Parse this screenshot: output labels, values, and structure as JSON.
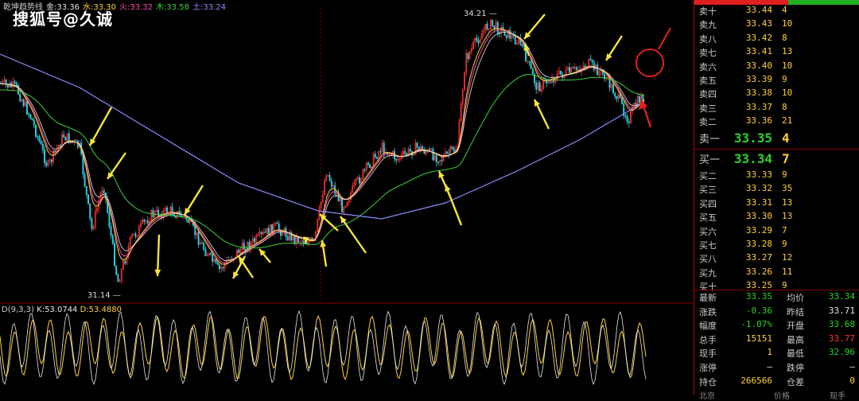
{
  "watermark": "搜狐号@久诚",
  "top_legend": {
    "name": "乾坤趋势线",
    "items": [
      {
        "label": "金:33.36",
        "color": "#e6e6e6"
      },
      {
        "label": "水:33.30",
        "color": "#ffd23c"
      },
      {
        "label": "火:33.32",
        "color": "#ff4da6"
      },
      {
        "label": "木:33.58",
        "color": "#3cd23c"
      },
      {
        "label": "土:33.24",
        "color": "#8c8cff"
      }
    ]
  },
  "price_labels": {
    "high": "34.21",
    "low": "31.14"
  },
  "kdj_legend": {
    "name": "D(9,3,3)",
    "k": "K:53.0744",
    "d": "D:53.4880"
  },
  "colors": {
    "up": "#ff3232",
    "down": "#2bd22b",
    "neutral": "#ffd23c",
    "grid": "#8b0000"
  },
  "order_book": {
    "asks": [
      {
        "name": "卖十",
        "price": "33.44",
        "vol": "4"
      },
      {
        "name": "卖九",
        "price": "33.43",
        "vol": "10"
      },
      {
        "name": "卖八",
        "price": "33.42",
        "vol": "8"
      },
      {
        "name": "卖七",
        "price": "33.41",
        "vol": "13"
      },
      {
        "name": "卖六",
        "price": "33.40",
        "vol": "10"
      },
      {
        "name": "卖五",
        "price": "33.39",
        "vol": "9"
      },
      {
        "name": "卖四",
        "price": "33.38",
        "vol": "10"
      },
      {
        "name": "卖三",
        "price": "33.37",
        "vol": "8"
      },
      {
        "name": "卖二",
        "price": "33.36",
        "vol": "21"
      },
      {
        "name": "卖一",
        "price": "33.35",
        "vol": "4"
      }
    ],
    "bids": [
      {
        "name": "买一",
        "price": "33.34",
        "vol": "7"
      },
      {
        "name": "买二",
        "price": "33.33",
        "vol": "9"
      },
      {
        "name": "买三",
        "price": "33.32",
        "vol": "35"
      },
      {
        "name": "买四",
        "price": "33.31",
        "vol": "13"
      },
      {
        "name": "买五",
        "price": "33.30",
        "vol": "13"
      },
      {
        "name": "买六",
        "price": "33.29",
        "vol": "7"
      },
      {
        "name": "买七",
        "price": "33.28",
        "vol": "9"
      },
      {
        "name": "买八",
        "price": "33.27",
        "vol": "12"
      },
      {
        "name": "买九",
        "price": "33.26",
        "vol": "11"
      },
      {
        "name": "买十",
        "price": "33.25",
        "vol": "9"
      }
    ]
  },
  "stats": [
    {
      "l1": "最新",
      "v1": "33.35",
      "c1": "#2bd22b",
      "l2": "均价",
      "v2": "33.34",
      "c2": "#2bd22b"
    },
    {
      "l1": "涨跌",
      "v1": "-0.36",
      "c1": "#2bd22b",
      "l2": "昨结",
      "v2": "33.71",
      "c2": "#e6e6e6"
    },
    {
      "l1": "幅度",
      "v1": "-1.07%",
      "c1": "#2bd22b",
      "l2": "开盘",
      "v2": "33.68",
      "c2": "#2bd22b"
    },
    {
      "l1": "总手",
      "v1": "15151",
      "c1": "#ffd23c",
      "l2": "最高",
      "v2": "33.77",
      "c2": "#ff3232"
    },
    {
      "l1": "现手",
      "v1": "1",
      "c1": "#ffd23c",
      "l2": "最低",
      "v2": "32.96",
      "c2": "#2bd22b"
    },
    {
      "l1": "涨停",
      "v1": "—",
      "c1": "#e6e6e6",
      "l2": "跌停",
      "v2": "—",
      "c2": "#e6e6e6"
    },
    {
      "l1": "持仓",
      "v1": "266566",
      "c1": "#ffd23c",
      "l2": "仓差",
      "v2": "0",
      "c2": "#ffd23c"
    }
  ],
  "footer": [
    "北京",
    "价格",
    "现手"
  ],
  "chart_data": {
    "type": "line",
    "price_high": 34.21,
    "price_low": 31.14,
    "series": [
      {
        "name": "金",
        "value": 33.36
      },
      {
        "name": "水",
        "value": 33.3
      },
      {
        "name": "火",
        "value": 33.32
      },
      {
        "name": "木",
        "value": 33.58
      },
      {
        "name": "土",
        "value": 33.24
      }
    ],
    "kdj": {
      "k": 53.0744,
      "d": 53.488
    }
  }
}
